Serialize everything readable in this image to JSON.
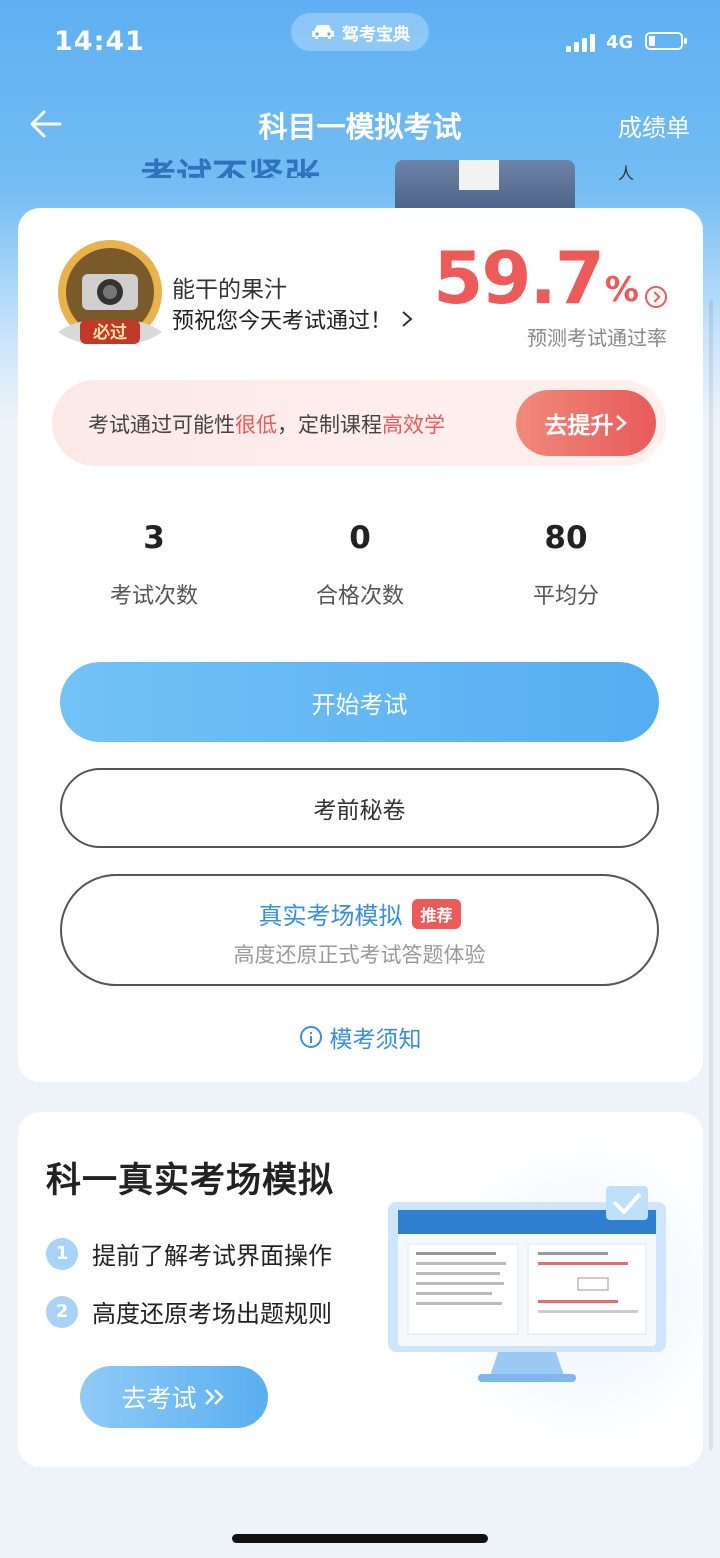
{
  "status_bar": {
    "time": "14:41",
    "app_name": "驾考宝典",
    "network": "4G",
    "battery_icon": "battery-icon"
  },
  "nav": {
    "title": "科目一模拟考试",
    "right_label": "成绩单"
  },
  "banner": {
    "text": "考试不紧张",
    "small_text": "人"
  },
  "profile": {
    "badge_text": "必过",
    "user_name": "能干的果汁",
    "wish": "预祝您今天考试通过！",
    "pass_rate": "59.7",
    "pass_rate_unit": "%",
    "pass_rate_label": "预测考试通过率"
  },
  "alert": {
    "text_part1": "考试通过可能性",
    "text_red1": "很低",
    "text_part2": "，定制课程",
    "text_red2": "高效学",
    "button": "去提升"
  },
  "stats": [
    {
      "value": "3",
      "label": "考试次数"
    },
    {
      "value": "0",
      "label": "合格次数"
    },
    {
      "value": "80",
      "label": "平均分"
    }
  ],
  "buttons": {
    "start_exam": "开始考试",
    "secret_paper": "考前秘卷",
    "real_sim_title": "真实考场模拟",
    "real_sim_tag": "推荐",
    "real_sim_sub": "高度还原正式考试答题体验",
    "notice": "模考须知"
  },
  "promo": {
    "title": "科一真实考场模拟",
    "items": [
      {
        "num": "1",
        "text": "提前了解考试界面操作"
      },
      {
        "num": "2",
        "text": "高度还原考场出题规则"
      }
    ],
    "button": "去考试"
  },
  "colors": {
    "accent_blue": "#55adf2",
    "alert_red": "#ec5a5a"
  }
}
